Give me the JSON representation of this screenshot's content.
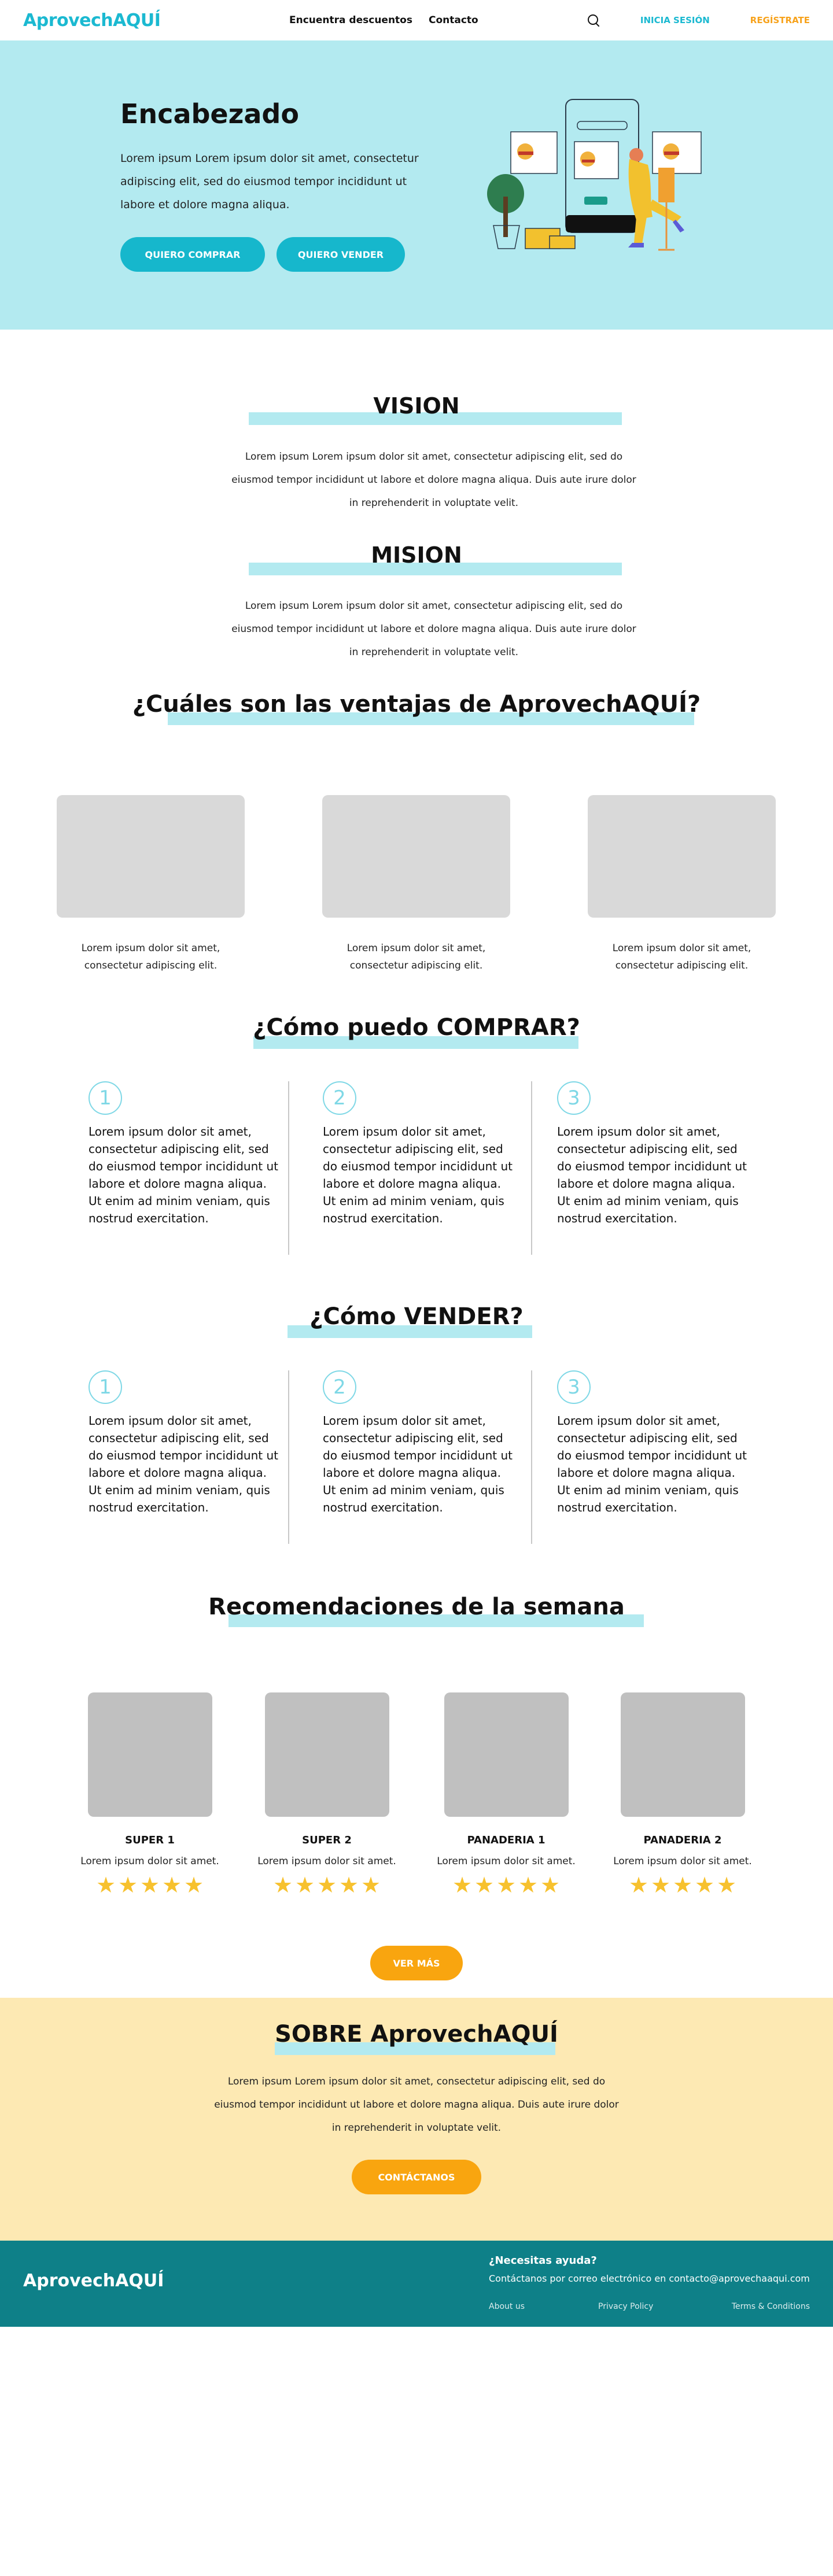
{
  "nav": {
    "logo": "AprovechAQUÍ",
    "links": [
      "Encuentra descuentos",
      "Contacto"
    ],
    "login": "INICIA SESIÓN",
    "signup": "REGÍSTRATE"
  },
  "hero": {
    "title": "Encabezado",
    "text": "Lorem ipsum Lorem ipsum dolor sit amet, consectetur adipiscing elit, sed do eiusmod tempor incididunt ut labore et dolore magna aliqua.",
    "buy_button": "QUIERO COMPRAR",
    "sell_button": "QUIERO VENDER"
  },
  "vision": {
    "title": "VISION",
    "text": "Lorem ipsum Lorem ipsum dolor sit amet, consectetur adipiscing elit, sed do eiusmod tempor incididunt ut labore et dolore magna aliqua. Duis aute irure dolor in reprehenderit in voluptate velit."
  },
  "mision": {
    "title": "MISION",
    "text": "Lorem ipsum Lorem ipsum dolor sit amet, consectetur adipiscing elit, sed do eiusmod tempor incididunt ut labore et dolore magna aliqua. Duis aute irure dolor in reprehenderit in voluptate velit."
  },
  "advantages": {
    "title": "¿Cuáles son las ventajas de AprovechAQUÍ?",
    "items": [
      {
        "text": "Lorem ipsum dolor sit amet, consectetur adipiscing elit."
      },
      {
        "text": "Lorem ipsum dolor sit amet, consectetur adipiscing elit."
      },
      {
        "text": "Lorem ipsum dolor sit amet, consectetur adipiscing elit."
      }
    ]
  },
  "buy": {
    "title": "¿Cómo puedo COMPRAR?",
    "steps": [
      {
        "num": "1",
        "text": "Lorem ipsum dolor sit amet, consectetur adipiscing elit, sed do eiusmod tempor incididunt ut labore et dolore magna aliqua. Ut enim ad minim veniam, quis nostrud exercitation."
      },
      {
        "num": "2",
        "text": "Lorem ipsum dolor sit amet, consectetur adipiscing elit, sed do eiusmod tempor incididunt ut labore et dolore magna aliqua. Ut enim ad minim veniam, quis nostrud exercitation."
      },
      {
        "num": "3",
        "text": "Lorem ipsum dolor sit amet, consectetur adipiscing elit, sed do eiusmod tempor incididunt ut labore et dolore magna aliqua. Ut enim ad minim veniam, quis nostrud exercitation."
      }
    ]
  },
  "sell": {
    "title": "¿Cómo VENDER?",
    "steps": [
      {
        "num": "1",
        "text": "Lorem ipsum dolor sit amet, consectetur adipiscing elit, sed do eiusmod tempor incididunt ut labore et dolore magna aliqua. Ut enim ad minim veniam, quis nostrud exercitation."
      },
      {
        "num": "2",
        "text": "Lorem ipsum dolor sit amet, consectetur adipiscing elit, sed do eiusmod tempor incididunt ut labore et dolore magna aliqua. Ut enim ad minim veniam, quis nostrud exercitation."
      },
      {
        "num": "3",
        "text": "Lorem ipsum dolor sit amet, consectetur adipiscing elit, sed do eiusmod tempor incididunt ut labore et dolore magna aliqua. Ut enim ad minim veniam, quis nostrud exercitation."
      }
    ]
  },
  "recommendations": {
    "title": "Recomendaciones de la semana",
    "items": [
      {
        "name": "SUPER 1",
        "desc": "Lorem ipsum dolor sit amet.",
        "rating": 5
      },
      {
        "name": "SUPER 2",
        "desc": "Lorem ipsum dolor sit amet.",
        "rating": 5
      },
      {
        "name": "PANADERIA 1",
        "desc": "Lorem ipsum dolor sit amet.",
        "rating": 5
      },
      {
        "name": "PANADERIA 2",
        "desc": "Lorem ipsum dolor sit amet.",
        "rating": 5
      }
    ],
    "more_button": "VER MÁS"
  },
  "about": {
    "title": "SOBRE AprovechAQUÍ",
    "text": "Lorem ipsum Lorem ipsum dolor sit amet, consectetur adipiscing elit, sed do eiusmod tempor incididunt ut labore et dolore magna aliqua. Duis aute irure dolor in reprehenderit in voluptate velit.",
    "contact_button": "CONTÁCTANOS"
  },
  "footer": {
    "logo": "AprovechAQUÍ",
    "help_title": "¿Necesitas ayuda?",
    "help_text": "Contáctanos por correo electrónico en contacto@aprovechaaqui.com",
    "links": [
      "About us",
      "Privacy Policy",
      "Terms & Conditions"
    ]
  },
  "colors": {
    "brand": "#1bb9d1",
    "accent": "#f7a21b",
    "hero_bg": "#b3eaf0",
    "about_bg": "#fde9b3",
    "footer_bg": "#0e8088",
    "star": "#f7c12e"
  }
}
